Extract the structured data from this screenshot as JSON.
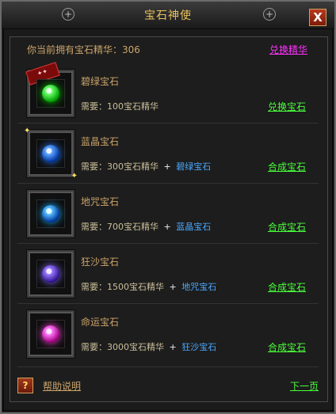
{
  "window": {
    "title": "宝石神使",
    "close_glyph": "X"
  },
  "header": {
    "essence_label": "你当前拥有宝石精华：306",
    "exchange_link": "兑换精华"
  },
  "items": [
    {
      "name": "碧绿宝石",
      "req_text": "需要：100宝石精华",
      "req_gem": "",
      "action": "兑换宝石"
    },
    {
      "name": "蓝晶宝石",
      "req_text": "需要：300宝石精华",
      "req_gem": "碧绿宝石",
      "action": "合成宝石"
    },
    {
      "name": "地咒宝石",
      "req_text": "需要：700宝石精华",
      "req_gem": "蓝晶宝石",
      "action": "合成宝石"
    },
    {
      "name": "狂沙宝石",
      "req_text": "需要：1500宝石精华",
      "req_gem": "地咒宝石",
      "action": "合成宝石"
    },
    {
      "name": "命运宝石",
      "req_text": "需要：3000宝石精华",
      "req_gem": "狂沙宝石",
      "action": "合成宝石"
    }
  ],
  "footer": {
    "help_glyph": "?",
    "help_link": "帮助说明",
    "next_page": "下一页"
  },
  "plus_sign": "+",
  "colors": {
    "title": "#e8c15a",
    "label": "#cba46a",
    "action_green": "#49ff3b",
    "exchange_magenta": "#ff32ff",
    "gem_ref_blue": "#4aa8ff"
  },
  "icons": [
    "gem-green-icon",
    "gem-blue-icon",
    "gem-cyan-icon",
    "gem-purple-icon",
    "gem-pink-icon"
  ]
}
